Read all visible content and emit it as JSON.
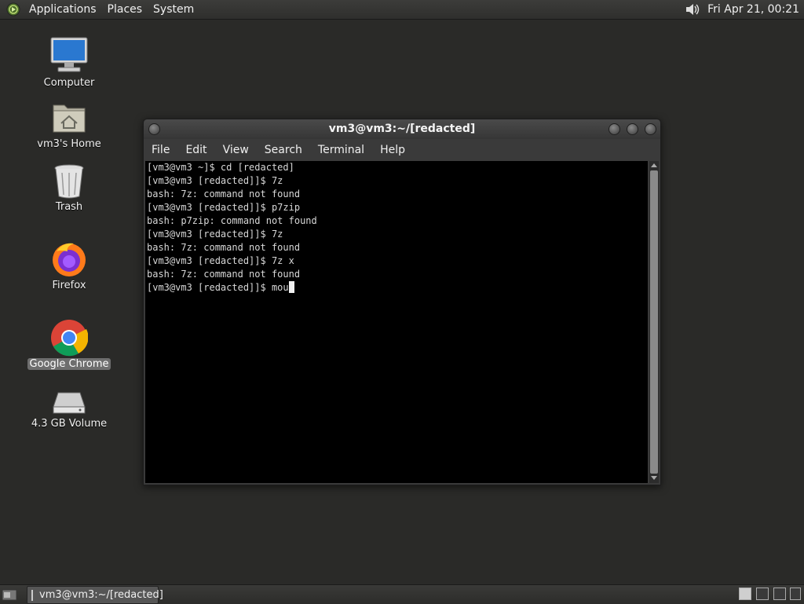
{
  "top_panel": {
    "menus": [
      "Applications",
      "Places",
      "System"
    ],
    "clock": "Fri Apr 21, 00:21"
  },
  "desktop": {
    "icons": [
      {
        "label": "Computer"
      },
      {
        "label": "vm3's Home"
      },
      {
        "label": "Trash"
      },
      {
        "label": "Firefox"
      },
      {
        "label": "Google Chrome"
      },
      {
        "label": "4.3 GB Volume"
      }
    ]
  },
  "terminal": {
    "title": "vm3@vm3:~/[redacted]",
    "menu": [
      "File",
      "Edit",
      "View",
      "Search",
      "Terminal",
      "Help"
    ],
    "lines": [
      "[vm3@vm3 ~]$ cd [redacted]",
      "[vm3@vm3 [redacted]]$ 7z",
      "bash: 7z: command not found",
      "[vm3@vm3 [redacted]]$ p7zip",
      "bash: p7zip: command not found",
      "[vm3@vm3 [redacted]]$ 7z",
      "bash: 7z: command not found",
      "[vm3@vm3 [redacted]]$ 7z x",
      "bash: 7z: command not found"
    ],
    "current_line": "[vm3@vm3 [redacted]]$ mou"
  },
  "taskbar": {
    "task_label": "vm3@vm3:~/[redacted]"
  }
}
